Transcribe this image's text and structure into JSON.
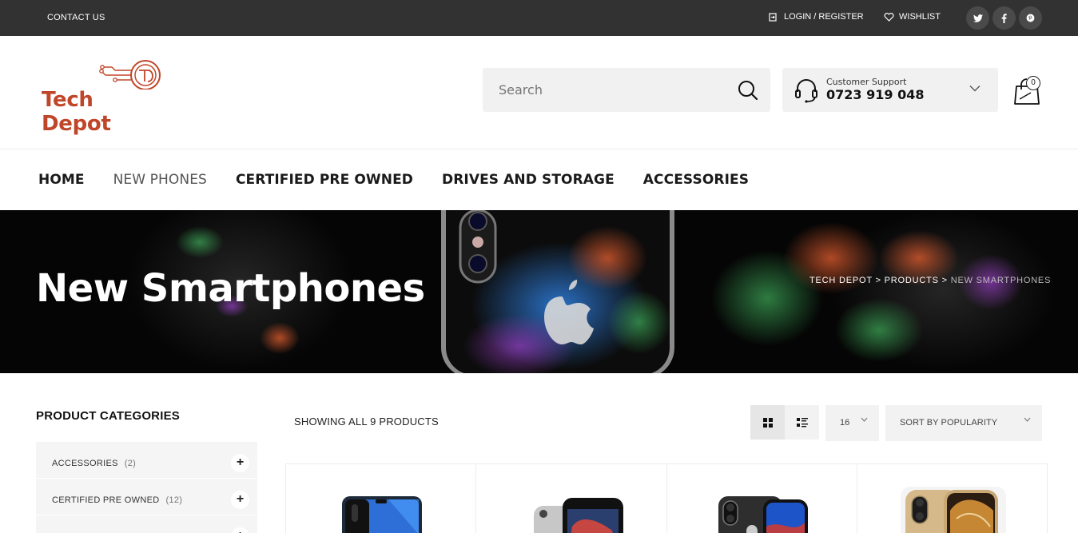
{
  "topbar": {
    "contact": "CONTACT US",
    "login": "LOGIN / REGISTER",
    "wishlist": "WISHLIST",
    "social": [
      "twitter-icon",
      "facebook-icon",
      "pinterest-icon"
    ]
  },
  "header": {
    "logo_text": "Tech Depot",
    "search_placeholder": "Search",
    "support_label": "Customer Support",
    "support_phone": "0723 919 048",
    "cart_count": "0"
  },
  "nav": [
    {
      "label": "HOME",
      "active": false
    },
    {
      "label": "NEW PHONES",
      "active": true
    },
    {
      "label": "CERTIFIED PRE OWNED",
      "active": false
    },
    {
      "label": "DRIVES AND STORAGE",
      "active": false
    },
    {
      "label": "ACCESSORIES",
      "active": false
    }
  ],
  "hero": {
    "title": "New Smartphones",
    "crumb_1": "TECH DEPOT",
    "crumb_2": "PRODUCTS",
    "crumb_current": "NEW SMARTPHONES",
    "separator": ">"
  },
  "sidebar": {
    "title": "PRODUCT CATEGORIES",
    "categories": [
      {
        "label": "ACCESSORIES",
        "count": "(2)"
      },
      {
        "label": "CERTIFIED PRE OWNED",
        "count": "(12)"
      }
    ]
  },
  "toolbar": {
    "showing": "SHOWING ALL 9 PRODUCTS",
    "per_page": "16",
    "sort": "SORT BY POPULARITY"
  },
  "colors": {
    "brand": "#c0462a",
    "topbar": "#323232",
    "panel": "#f1f1f1"
  }
}
